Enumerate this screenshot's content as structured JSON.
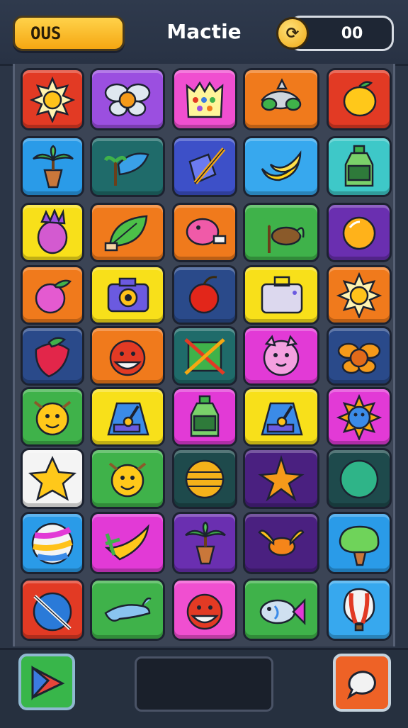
{
  "header": {
    "score_text": "OUS",
    "title": "Mactie",
    "coins": "00",
    "coin_icon": "coin-refresh-icon"
  },
  "colors": {
    "red": "#e23a24",
    "purple": "#9b4fe0",
    "pink": "#f04fd0",
    "orange": "#f07a1c",
    "blue": "#2a9be8",
    "teal": "#1f6b6a",
    "indigo": "#3d50c8",
    "sky": "#37a8ee",
    "aqua": "#3ec8c8",
    "yellow": "#f8e01a",
    "green": "#3fb24a",
    "violet": "#6a2fb0",
    "navy": "#2a4a8a",
    "magenta": "#e23ad6",
    "white": "#f4f4f4",
    "darkteal": "#1e4a4c",
    "deeppurple": "#4a2080"
  },
  "grid": [
    [
      {
        "bg": "red",
        "icon": "sun-icon"
      },
      {
        "bg": "purple",
        "icon": "butterfly-icon"
      },
      {
        "bg": "pink",
        "icon": "crown-basket-icon"
      },
      {
        "bg": "orange",
        "icon": "leafy-fish-icon"
      },
      {
        "bg": "red",
        "icon": "lemon-icon"
      }
    ],
    [
      {
        "bg": "blue",
        "icon": "potted-palm-icon"
      },
      {
        "bg": "teal",
        "icon": "palm-leaf-icon"
      },
      {
        "bg": "indigo",
        "icon": "crystal-wand-icon"
      },
      {
        "bg": "sky",
        "icon": "banana-icon"
      },
      {
        "bg": "aqua",
        "icon": "bottle-icon"
      }
    ],
    [
      {
        "bg": "yellow",
        "icon": "pineapple-icon"
      },
      {
        "bg": "orange",
        "icon": "leaf-icon"
      },
      {
        "bg": "orange",
        "icon": "pink-blob-icon"
      },
      {
        "bg": "green",
        "icon": "coconut-icon"
      },
      {
        "bg": "violet",
        "icon": "orange-ball-icon"
      }
    ],
    [
      {
        "bg": "orange",
        "icon": "peach-icon"
      },
      {
        "bg": "yellow",
        "icon": "camera-icon"
      },
      {
        "bg": "navy",
        "icon": "cherry-icon"
      },
      {
        "bg": "yellow",
        "icon": "suitcase-icon"
      },
      {
        "bg": "orange",
        "icon": "sun-icon"
      }
    ],
    [
      {
        "bg": "navy",
        "icon": "strawberry-icon"
      },
      {
        "bg": "orange",
        "icon": "red-face-icon"
      },
      {
        "bg": "teal",
        "icon": "crossed-sticks-icon"
      },
      {
        "bg": "magenta",
        "icon": "pig-icon"
      },
      {
        "bg": "navy",
        "icon": "orange-flower-icon"
      }
    ],
    [
      {
        "bg": "green",
        "icon": "smiley-sun-icon"
      },
      {
        "bg": "yellow",
        "icon": "slot-machine-icon"
      },
      {
        "bg": "magenta",
        "icon": "bottle-icon"
      },
      {
        "bg": "yellow",
        "icon": "slot-machine-icon"
      },
      {
        "bg": "magenta",
        "icon": "blue-star-face-icon"
      }
    ],
    [
      {
        "bg": "white",
        "icon": "star-icon"
      },
      {
        "bg": "green",
        "icon": "smiley-sun-icon"
      },
      {
        "bg": "darkteal",
        "icon": "lantern-icon"
      },
      {
        "bg": "deeppurple",
        "icon": "starfish-icon"
      },
      {
        "bg": "darkteal",
        "icon": "green-ball-icon"
      }
    ],
    [
      {
        "bg": "blue",
        "icon": "beach-ball-icon"
      },
      {
        "bg": "magenta",
        "icon": "wing-icon"
      },
      {
        "bg": "violet",
        "icon": "potted-palm-icon"
      },
      {
        "bg": "deeppurple",
        "icon": "winged-fish-icon"
      },
      {
        "bg": "blue",
        "icon": "tree-icon"
      }
    ],
    [
      {
        "bg": "red",
        "icon": "planet-icon"
      },
      {
        "bg": "green",
        "icon": "dolphin-icon"
      },
      {
        "bg": "pink",
        "icon": "red-face-icon"
      },
      {
        "bg": "green",
        "icon": "fish-icon"
      },
      {
        "bg": "sky",
        "icon": "hot-air-balloon-icon"
      }
    ]
  ],
  "footer": {
    "play_icon": "play-icon",
    "chat_icon": "chat-icon"
  }
}
